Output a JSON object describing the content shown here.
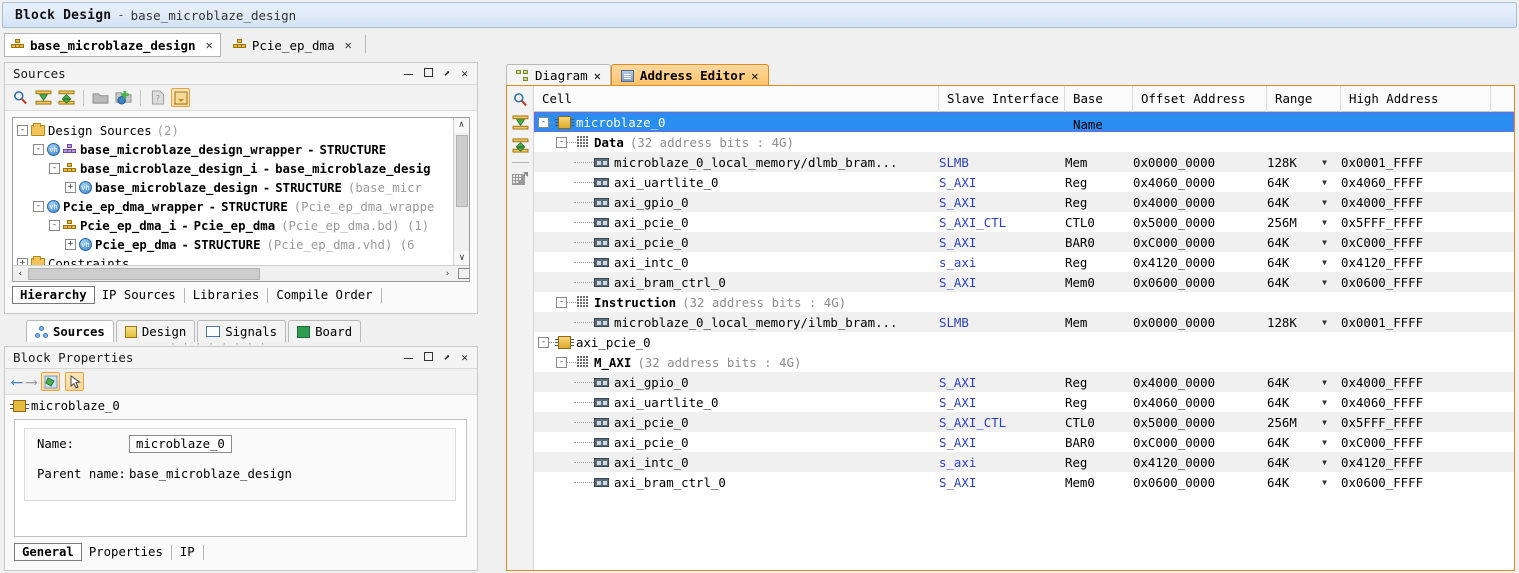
{
  "titlebar": {
    "main": "Block Design",
    "dash": "-",
    "sub": "base_microblaze_design"
  },
  "design_tabs": [
    {
      "label": "base_microblaze_design",
      "icon": "block-design-icon",
      "close": "✕",
      "active": true
    },
    {
      "label": "Pcie_ep_dma",
      "icon": "block-design-icon",
      "close": "✕",
      "active": false
    }
  ],
  "sources_panel": {
    "title": "Sources",
    "win_buttons": {
      "minimize": "—",
      "maximize": "□",
      "float": "⬈",
      "close": "✕"
    },
    "toolbar": [
      "search-icon",
      "collapse-all-icon",
      "expand-all-icon",
      "open-folder-icon",
      "add-sources-icon",
      "file-icon",
      "import-icon"
    ],
    "tree": [
      {
        "indent": 0,
        "toggle": "-",
        "icon": "folder-icon",
        "label": "Design Sources",
        "suffix": "(2)",
        "bold": false
      },
      {
        "indent": 1,
        "toggle": "-",
        "icon": "vhd-icon",
        "icon2": "block-design-purple-icon",
        "label": "base_microblaze_design_wrapper",
        "dash": "-",
        "type": "STRUCTURE",
        "bold": true
      },
      {
        "indent": 2,
        "toggle": "-",
        "icon": "block-design-icon",
        "label": "base_microblaze_design_i",
        "dash": "-",
        "type": "base_microblaze_desig",
        "bold": true
      },
      {
        "indent": 3,
        "toggle": "+",
        "icon": "vhd-icon",
        "label": "base_microblaze_design",
        "dash": "-",
        "type": "STRUCTURE",
        "suffix": "(base_micr",
        "bold": true
      },
      {
        "indent": 1,
        "toggle": "-",
        "icon": "vhd-icon",
        "label": "Pcie_ep_dma_wrapper",
        "dash": "-",
        "type": "STRUCTURE",
        "suffix": "(Pcie_ep_dma_wrappe",
        "bold": true
      },
      {
        "indent": 2,
        "toggle": "-",
        "icon": "block-design-icon",
        "label": "Pcie_ep_dma_i",
        "dash": "-",
        "type": "Pcie_ep_dma",
        "suffix": "(Pcie_ep_dma.bd) (1)",
        "bold": true
      },
      {
        "indent": 3,
        "toggle": "+",
        "icon": "vhd-icon",
        "label": "Pcie_ep_dma",
        "dash": "-",
        "type": "STRUCTURE",
        "suffix": "(Pcie_ep_dma.vhd) (6",
        "bold": true
      },
      {
        "indent": 0,
        "toggle": "+",
        "icon": "folder-icon",
        "label": "Constraints",
        "suffix": "",
        "bold": false
      }
    ],
    "sub_tabs": [
      {
        "label": "Hierarchy",
        "selected": true
      },
      {
        "label": "IP Sources",
        "selected": false
      },
      {
        "label": "Libraries",
        "selected": false
      },
      {
        "label": "Compile Order",
        "selected": false
      }
    ],
    "scroll": {
      "up": "∧",
      "down": "∨",
      "left": "‹",
      "right": "›"
    }
  },
  "view_tabs": [
    {
      "label": "Sources",
      "icon": "hierarchy-icon",
      "active": true
    },
    {
      "label": "Design",
      "icon": "design-icon",
      "active": false
    },
    {
      "label": "Signals",
      "icon": "signals-icon",
      "active": false
    },
    {
      "label": "Board",
      "icon": "board-icon",
      "active": false
    }
  ],
  "properties_panel": {
    "title": "Block Properties",
    "win_buttons": {
      "minimize": "—",
      "maximize": "□",
      "float": "⬈",
      "close": "✕"
    },
    "toolbar": [
      "back-arrow-icon",
      "forward-arrow-icon",
      "refresh-icon",
      "select-cursor-icon"
    ],
    "object_name": "microblaze_0",
    "fields": [
      {
        "label": "Name:",
        "value": "microblaze_0",
        "is_input": true
      },
      {
        "label": "Parent name:",
        "value": "base_microblaze_design",
        "is_input": false
      }
    ],
    "tabs": [
      {
        "label": "General",
        "selected": true
      },
      {
        "label": "Properties",
        "selected": false
      },
      {
        "label": "IP",
        "selected": false
      }
    ]
  },
  "editor": {
    "tabs": [
      {
        "label": "Diagram",
        "icon": "diagram-icon",
        "close": "✕",
        "active": false
      },
      {
        "label": "Address Editor",
        "icon": "address-editor-icon",
        "close": "✕",
        "active": true
      }
    ],
    "side_toolbar": [
      "search-icon",
      "collapse-all-icon",
      "expand-all-icon",
      "auto-assign-icon"
    ],
    "columns": [
      "Cell",
      "Slave Interface",
      "Base Name",
      "Offset Address",
      "Range",
      "High Address"
    ],
    "caret": "▼",
    "rows": [
      {
        "level": 0,
        "toggle": "-",
        "icon": "processor-icon",
        "cell": "microblaze_0",
        "slave": "",
        "base": "",
        "offset": "",
        "range": "",
        "high": "",
        "selected": true,
        "stripe": false
      },
      {
        "level": 1,
        "toggle": "-",
        "icon": "address-space-icon",
        "cell": "Data",
        "note": "(32 address bits : 4G)",
        "slave": "",
        "base": "",
        "offset": "",
        "range": "",
        "high": "",
        "selected": false,
        "stripe": false
      },
      {
        "level": 2,
        "toggle": "",
        "icon": "segment-icon",
        "cell": "microblaze_0_local_memory/dlmb_bram...",
        "slave": "SLMB",
        "base": "Mem",
        "offset": "0x0000_0000",
        "range": "128K",
        "high": "0x0001_FFFF",
        "selected": false,
        "stripe": true
      },
      {
        "level": 2,
        "toggle": "",
        "icon": "segment-icon",
        "cell": "axi_uartlite_0",
        "slave": "S_AXI",
        "base": "Reg",
        "offset": "0x4060_0000",
        "range": "64K",
        "high": "0x4060_FFFF",
        "selected": false,
        "stripe": false
      },
      {
        "level": 2,
        "toggle": "",
        "icon": "segment-icon",
        "cell": "axi_gpio_0",
        "slave": "S_AXI",
        "base": "Reg",
        "offset": "0x4000_0000",
        "range": "64K",
        "high": "0x4000_FFFF",
        "selected": false,
        "stripe": true
      },
      {
        "level": 2,
        "toggle": "",
        "icon": "segment-icon",
        "cell": "axi_pcie_0",
        "slave": "S_AXI_CTL",
        "base": "CTL0",
        "offset": "0x5000_0000",
        "range": "256M",
        "high": "0x5FFF_FFFF",
        "selected": false,
        "stripe": false
      },
      {
        "level": 2,
        "toggle": "",
        "icon": "segment-icon",
        "cell": "axi_pcie_0",
        "slave": "S_AXI",
        "base": "BAR0",
        "offset": "0xC000_0000",
        "range": "64K",
        "high": "0xC000_FFFF",
        "selected": false,
        "stripe": true
      },
      {
        "level": 2,
        "toggle": "",
        "icon": "segment-icon",
        "cell": "axi_intc_0",
        "slave": "s_axi",
        "base": "Reg",
        "offset": "0x4120_0000",
        "range": "64K",
        "high": "0x4120_FFFF",
        "selected": false,
        "stripe": false
      },
      {
        "level": 2,
        "toggle": "",
        "icon": "segment-icon",
        "cell": "axi_bram_ctrl_0",
        "slave": "S_AXI",
        "base": "Mem0",
        "offset": "0x0600_0000",
        "range": "64K",
        "high": "0x0600_FFFF",
        "selected": false,
        "stripe": true
      },
      {
        "level": 1,
        "toggle": "-",
        "icon": "address-space-icon",
        "cell": "Instruction",
        "note": "(32 address bits : 4G)",
        "slave": "",
        "base": "",
        "offset": "",
        "range": "",
        "high": "",
        "selected": false,
        "stripe": false
      },
      {
        "level": 2,
        "toggle": "",
        "icon": "segment-icon",
        "cell": "microblaze_0_local_memory/ilmb_bram...",
        "slave": "SLMB",
        "base": "Mem",
        "offset": "0x0000_0000",
        "range": "128K",
        "high": "0x0001_FFFF",
        "selected": false,
        "stripe": true
      },
      {
        "level": 0,
        "toggle": "-",
        "icon": "processor-icon",
        "cell": "axi_pcie_0",
        "slave": "",
        "base": "",
        "offset": "",
        "range": "",
        "high": "",
        "selected": false,
        "stripe": false
      },
      {
        "level": 1,
        "toggle": "-",
        "icon": "address-space-icon",
        "cell": "M_AXI",
        "note": "(32 address bits : 4G)",
        "slave": "",
        "base": "",
        "offset": "",
        "range": "",
        "high": "",
        "selected": false,
        "stripe": false
      },
      {
        "level": 2,
        "toggle": "",
        "icon": "segment-icon",
        "cell": "axi_gpio_0",
        "slave": "S_AXI",
        "base": "Reg",
        "offset": "0x4000_0000",
        "range": "64K",
        "high": "0x4000_FFFF",
        "selected": false,
        "stripe": true
      },
      {
        "level": 2,
        "toggle": "",
        "icon": "segment-icon",
        "cell": "axi_uartlite_0",
        "slave": "S_AXI",
        "base": "Reg",
        "offset": "0x4060_0000",
        "range": "64K",
        "high": "0x4060_FFFF",
        "selected": false,
        "stripe": false
      },
      {
        "level": 2,
        "toggle": "",
        "icon": "segment-icon",
        "cell": "axi_pcie_0",
        "slave": "S_AXI_CTL",
        "base": "CTL0",
        "offset": "0x5000_0000",
        "range": "256M",
        "high": "0x5FFF_FFFF",
        "selected": false,
        "stripe": true
      },
      {
        "level": 2,
        "toggle": "",
        "icon": "segment-icon",
        "cell": "axi_pcie_0",
        "slave": "S_AXI",
        "base": "BAR0",
        "offset": "0xC000_0000",
        "range": "64K",
        "high": "0xC000_FFFF",
        "selected": false,
        "stripe": false
      },
      {
        "level": 2,
        "toggle": "",
        "icon": "segment-icon",
        "cell": "axi_intc_0",
        "slave": "s_axi",
        "base": "Reg",
        "offset": "0x4120_0000",
        "range": "64K",
        "high": "0x4120_FFFF",
        "selected": false,
        "stripe": true
      },
      {
        "level": 2,
        "toggle": "",
        "icon": "segment-icon",
        "cell": "axi_bram_ctrl_0",
        "slave": "S_AXI",
        "base": "Mem0",
        "offset": "0x0600_0000",
        "range": "64K",
        "high": "0x0600_FFFF",
        "selected": false,
        "stripe": false
      }
    ]
  },
  "colors": {
    "accent_orange": "#e08b20",
    "selection_blue": "#2a8ef0",
    "link_blue": "#2b3fc4",
    "stripe": "#f0f0f0"
  }
}
